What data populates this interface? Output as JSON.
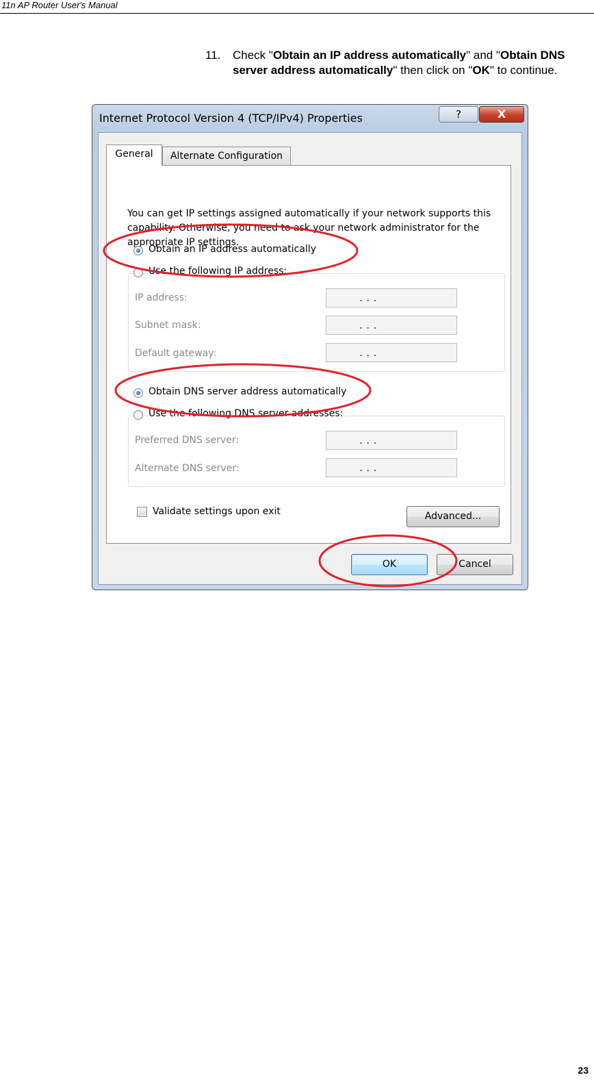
{
  "header": {
    "title": "11n AP Router User's Manual"
  },
  "step": {
    "number": "11.",
    "pre": "Check \"",
    "bold1": "Obtain an IP address automatically",
    "mid1": "\" and \"",
    "bold2": "Obtain DNS server address automatically",
    "mid2": "\" then click on \"",
    "bold3": "OK",
    "post": "\" to continue."
  },
  "dialog": {
    "title": "Internet Protocol Version 4 (TCP/IPv4) Properties",
    "help_label": "?",
    "close_label": "X",
    "tabs": [
      "General",
      "Alternate Configuration"
    ],
    "intro": "You can get IP settings assigned automatically if your network supports this capability. Otherwise, you need to ask your network administrator for the appropriate IP settings.",
    "radio_auto_ip": "Obtain an IP address automatically",
    "radio_manual_ip": "Use the following IP address:",
    "ip_fields": [
      {
        "label": "IP address:",
        "value": ".      .      ."
      },
      {
        "label": "Subnet mask:",
        "value": ".      .      ."
      },
      {
        "label": "Default gateway:",
        "value": ".      .      ."
      }
    ],
    "radio_auto_dns": "Obtain DNS server address automatically",
    "radio_manual_dns": "Use the following DNS server addresses:",
    "dns_fields": [
      {
        "label": "Preferred DNS server:",
        "value": ".      .      ."
      },
      {
        "label": "Alternate DNS server:",
        "value": ".      .      ."
      }
    ],
    "validate_label": "Validate settings upon exit",
    "advanced_label": "Advanced...",
    "ok_label": "OK",
    "cancel_label": "Cancel",
    "auto_ip_selected": true,
    "auto_dns_selected": true,
    "validate_checked": false
  },
  "annotation_color": "#e0232b",
  "footer": {
    "page_number": "23"
  }
}
